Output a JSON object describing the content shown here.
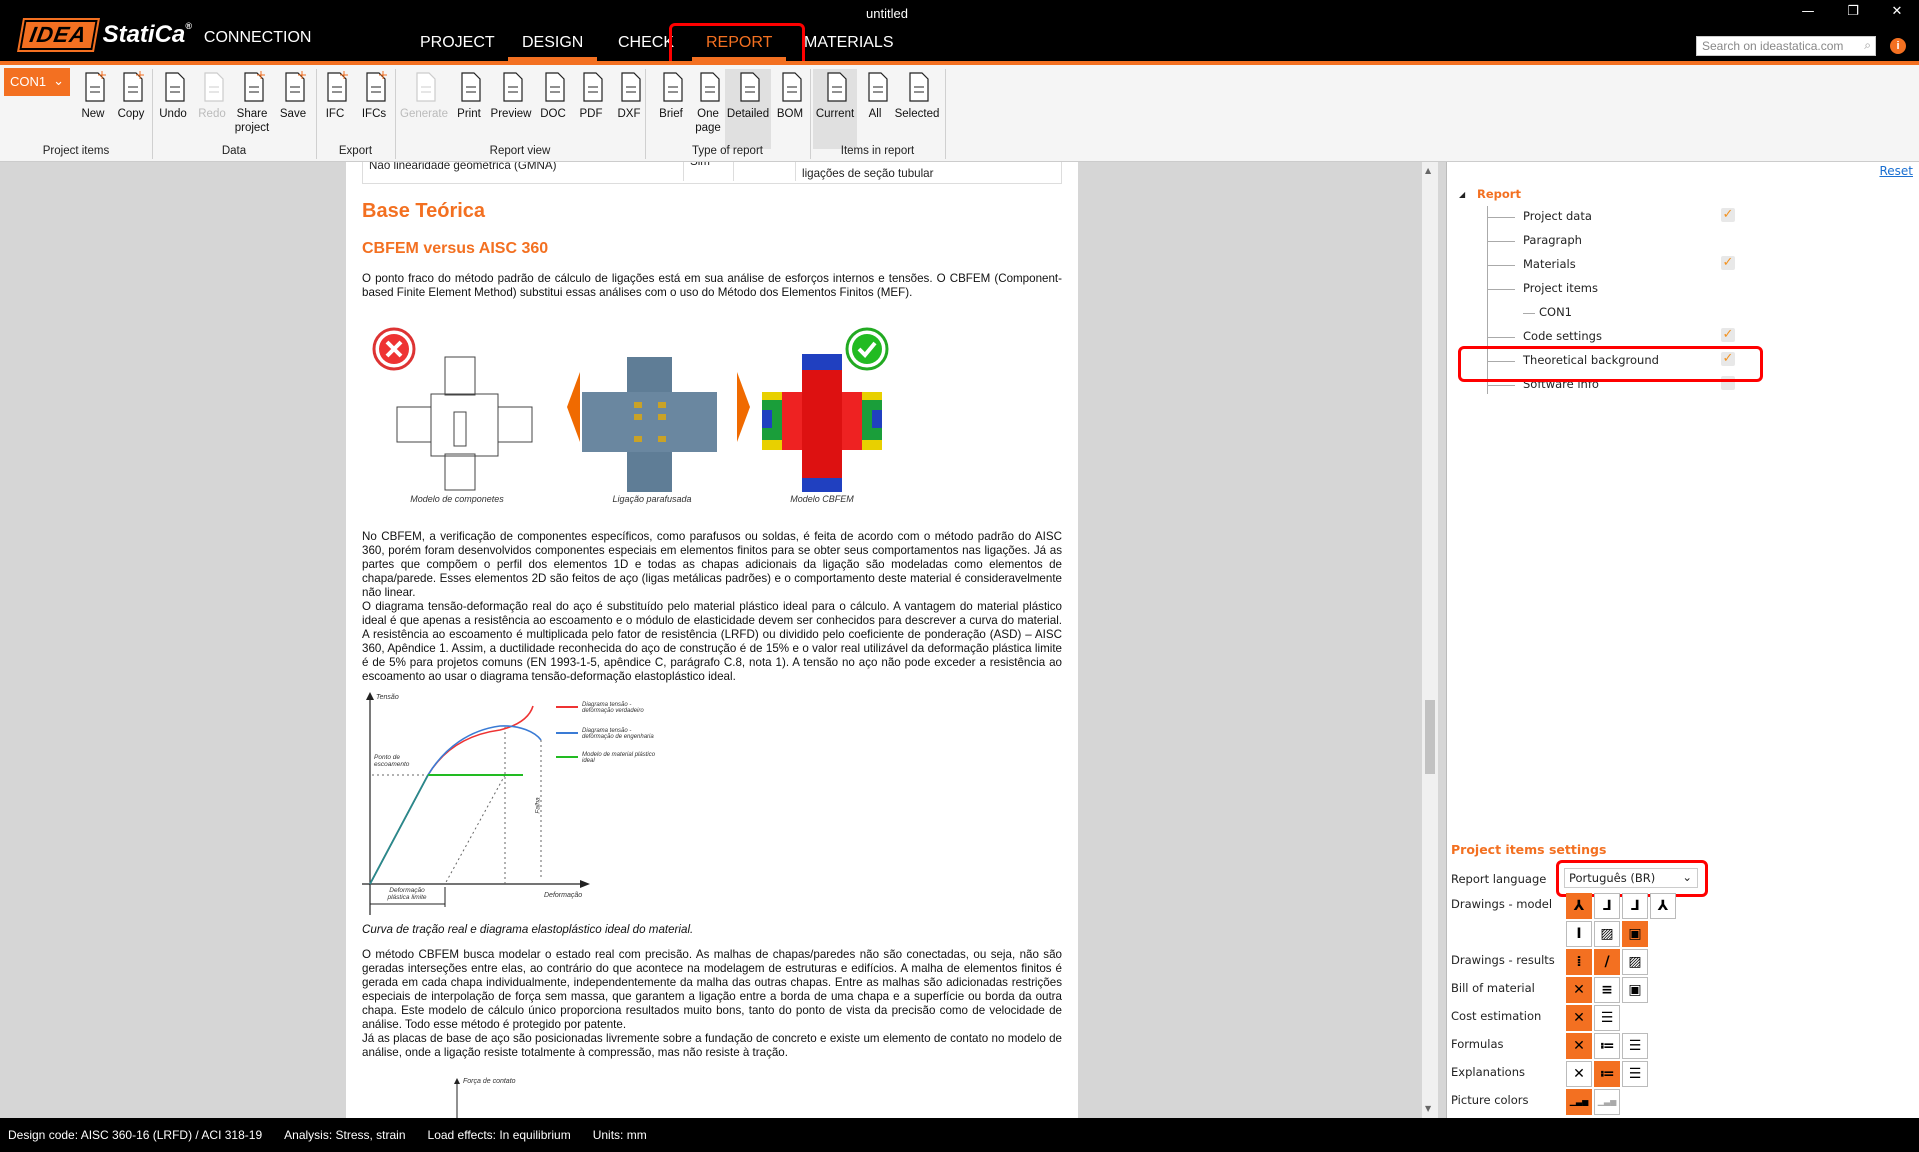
{
  "app": {
    "logo_idea": "IDEA",
    "logo_statica": "StatiCa",
    "logo_reg": "®",
    "product": "CONNECTION",
    "window_title": "untitled",
    "search_placeholder": "Search on ideastatica.com",
    "info": "i",
    "win_min": "—",
    "win_restore": "❐",
    "win_close": "✕"
  },
  "tabs": [
    {
      "label": "PROJECT"
    },
    {
      "label": "DESIGN"
    },
    {
      "label": "CHECK"
    },
    {
      "label": "REPORT"
    },
    {
      "label": "MATERIALS"
    }
  ],
  "ribbon": {
    "item_selector": "CON1",
    "buttons": [
      {
        "id": "new",
        "label": "New",
        "icon": "new-file-icon"
      },
      {
        "id": "copy",
        "label": "Copy",
        "icon": "copy-icon"
      },
      {
        "id": "undo",
        "label": "Undo",
        "icon": "undo-icon"
      },
      {
        "id": "redo",
        "label": "Redo",
        "icon": "redo-icon",
        "disabled": true
      },
      {
        "id": "share",
        "label": "Share\nproject",
        "icon": "share-icon"
      },
      {
        "id": "save",
        "label": "Save",
        "icon": "save-icon"
      },
      {
        "id": "ifc",
        "label": "IFC",
        "icon": "ifc-icon"
      },
      {
        "id": "ifcs",
        "label": "IFCs",
        "icon": "ifcs-icon"
      },
      {
        "id": "generate",
        "label": "Generate",
        "icon": "refresh-icon",
        "disabled": true
      },
      {
        "id": "print",
        "label": "Print",
        "icon": "print-icon"
      },
      {
        "id": "preview",
        "label": "Preview",
        "icon": "preview-icon"
      },
      {
        "id": "doc",
        "label": "DOC",
        "icon": "doc-icon"
      },
      {
        "id": "pdf",
        "label": "PDF",
        "icon": "pdf-icon"
      },
      {
        "id": "dxf",
        "label": "DXF",
        "icon": "dxf-icon"
      },
      {
        "id": "brief",
        "label": "Brief",
        "icon": "brief-icon"
      },
      {
        "id": "onepage",
        "label": "One\npage",
        "icon": "one-page-icon"
      },
      {
        "id": "detailed",
        "label": "Detailed",
        "icon": "detailed-icon",
        "selected": true
      },
      {
        "id": "bom",
        "label": "BOM",
        "icon": "bom-icon"
      },
      {
        "id": "current",
        "label": "Current",
        "icon": "current-items-icon",
        "selected": true
      },
      {
        "id": "all",
        "label": "All",
        "icon": "all-items-icon"
      },
      {
        "id": "selected",
        "label": "Selected",
        "icon": "selected-items-icon"
      }
    ],
    "groups": [
      "Project items",
      "Data",
      "Export",
      "Report view",
      "Type of report",
      "Items in report"
    ]
  },
  "document": {
    "table_row": {
      "c1": "Não linearidade geométrica (GMNA)",
      "c2": "Sim",
      "c4": "ligações de seção tubular"
    },
    "h1": "Base Teórica",
    "h2": "CBFEM versus AISC 360",
    "p1": "O ponto fraco do método padrão de cálculo de ligações está em sua análise de esforços internos e tensões. O CBFEM (Component-based Finite Element Method) substitui essas análises com o uso do Método dos Elementos Finitos (MEF).",
    "fig1": {
      "cap1": "Modelo de componetes",
      "cap2": "Ligação parafusada",
      "cap3": "Modelo CBFEM"
    },
    "p2": "No CBFEM, a verificação de componentes específicos, como parafusos ou soldas, é feita de acordo com o método padrão do AISC 360, porém foram desenvolvidos componentes especiais em elementos finitos para se obter seus comportamentos nas ligações. Já as partes que compõem o perfil dos elementos 1D e todas as chapas adicionais da ligação são modeladas como elementos de chapa/parede. Esses elementos 2D são feitos de aço (ligas metálicas padrões) e o comportamento deste material é consideravelmente não linear.",
    "p3": "O diagrama tensão-deformação real do aço é substituído pelo material plástico ideal para o cálculo. A vantagem do material plástico ideal é que apenas a resistência ao escoamento e o módulo de elasticidade devem ser conhecidos para descrever a curva do material. A resistência ao escoamento é multiplicada pelo fator de resistência (LRFD) ou dividido pelo coeficiente de ponderação (ASD) – AISC 360, Apêndice 1. Assim, a ductilidade reconhecida do aço de construção é de 15% e o valor real utilizável da deformação plástica limite é de 5% para projetos comuns (EN 1993-1-5, apêndice C, parágrafo C.8, nota 1). A tensão no aço não pode exceder a resistência ao escoamento ao usar o diagrama tensão-deformação elastoplástico ideal.",
    "fig2": {
      "y_axis": "Tensão",
      "x_axis": "Deformação",
      "yield": "Ponto de escoamento",
      "failure": "Falha",
      "plastic_limit": "Deformação plástica limite",
      "leg_red": "Diagrama tensão - deformação verdadeiro",
      "leg_blue": "Diagrama tensão - deformação de engenharia",
      "leg_green": "Modelo de material plástico ideal"
    },
    "caption2": "Curva de tração real e diagrama elastoplástico ideal do material.",
    "p4": "O método CBFEM busca modelar o estado real com precisão. As malhas de chapas/paredes não são conectadas, ou seja, não são geradas interseções entre elas, ao contrário do que acontece na modelagem de estruturas e edifícios. A malha de elementos finitos é gerada em cada chapa individualmente, independentemente da malha das outras chapas. Entre as malhas são adicionadas restrições especiais de interpolação de força sem massa, que garantem a ligação entre a borda de uma chapa e a superfície ou borda da outra chapa. Este modelo de cálculo único proporciona resultados muito bons, tanto do ponto de vista da precisão como de velocidade de análise. Todo esse método é protegido por patente.",
    "p5": "Já as placas de base de aço são posicionadas livremente sobre a fundação de concreto e existe um elemento de contato no modelo de análise, onde a ligação resiste totalmente à compressão, mas não resiste à tração.",
    "fig3_label": "Força de contato"
  },
  "panel": {
    "reset": "Reset",
    "tree_root": "Report",
    "tree": [
      {
        "label": "Project data",
        "checked": true
      },
      {
        "label": "Paragraph",
        "checked": null
      },
      {
        "label": "Materials",
        "checked": true
      },
      {
        "label": "Project items",
        "checked": null
      },
      {
        "label": "CON1",
        "checked": null,
        "child": true
      },
      {
        "label": "Code settings",
        "checked": true
      },
      {
        "label": "Theoretical background",
        "checked": true
      },
      {
        "label": "Software info",
        "checked": false
      }
    ],
    "settings_title": "Project items settings",
    "language_label": "Report language",
    "language_value": "Português (BR)",
    "rows": [
      {
        "label": "Drawings - model",
        "buttons": [
          {
            "icon": "axes-iso-icon",
            "on": true
          },
          {
            "icon": "axes-front-icon"
          },
          {
            "icon": "axes-side-icon"
          },
          {
            "icon": "axes-top-icon"
          }
        ]
      },
      {
        "label": "",
        "buttons": [
          {
            "icon": "section-icon"
          },
          {
            "icon": "picture-icon"
          },
          {
            "icon": "detail-picture-icon",
            "on": true
          }
        ]
      },
      {
        "label": "Drawings - results",
        "buttons": [
          {
            "icon": "traffic-light-icon",
            "on": true
          },
          {
            "icon": "stress-icon",
            "on": true
          },
          {
            "icon": "picture-icon"
          }
        ]
      },
      {
        "label": "Bill of material",
        "buttons": [
          {
            "icon": "none-icon",
            "on": true
          },
          {
            "icon": "table-icon"
          },
          {
            "icon": "detail-picture-icon"
          }
        ]
      },
      {
        "label": "Cost estimation",
        "buttons": [
          {
            "icon": "none-icon",
            "on": true
          },
          {
            "icon": "list-icon"
          }
        ]
      },
      {
        "label": "Formulas",
        "buttons": [
          {
            "icon": "none-icon",
            "on": true
          },
          {
            "icon": "short-list-icon"
          },
          {
            "icon": "list-icon"
          }
        ]
      },
      {
        "label": "Explanations",
        "buttons": [
          {
            "icon": "none-icon"
          },
          {
            "icon": "short-list-icon",
            "on": true
          },
          {
            "icon": "list-icon"
          }
        ]
      },
      {
        "label": "Picture colors",
        "buttons": [
          {
            "icon": "color-bars-icon",
            "on": true
          },
          {
            "icon": "grey-bars-icon"
          }
        ]
      }
    ]
  },
  "status": {
    "code": "Design code: AISC 360-16 (LRFD) / ACI 318-19",
    "analysis": "Analysis: Stress, strain",
    "load": "Load effects: In equilibrium",
    "units": "Units: mm"
  },
  "colors": {
    "accent": "#f37021",
    "highlight": "#ff0000"
  }
}
